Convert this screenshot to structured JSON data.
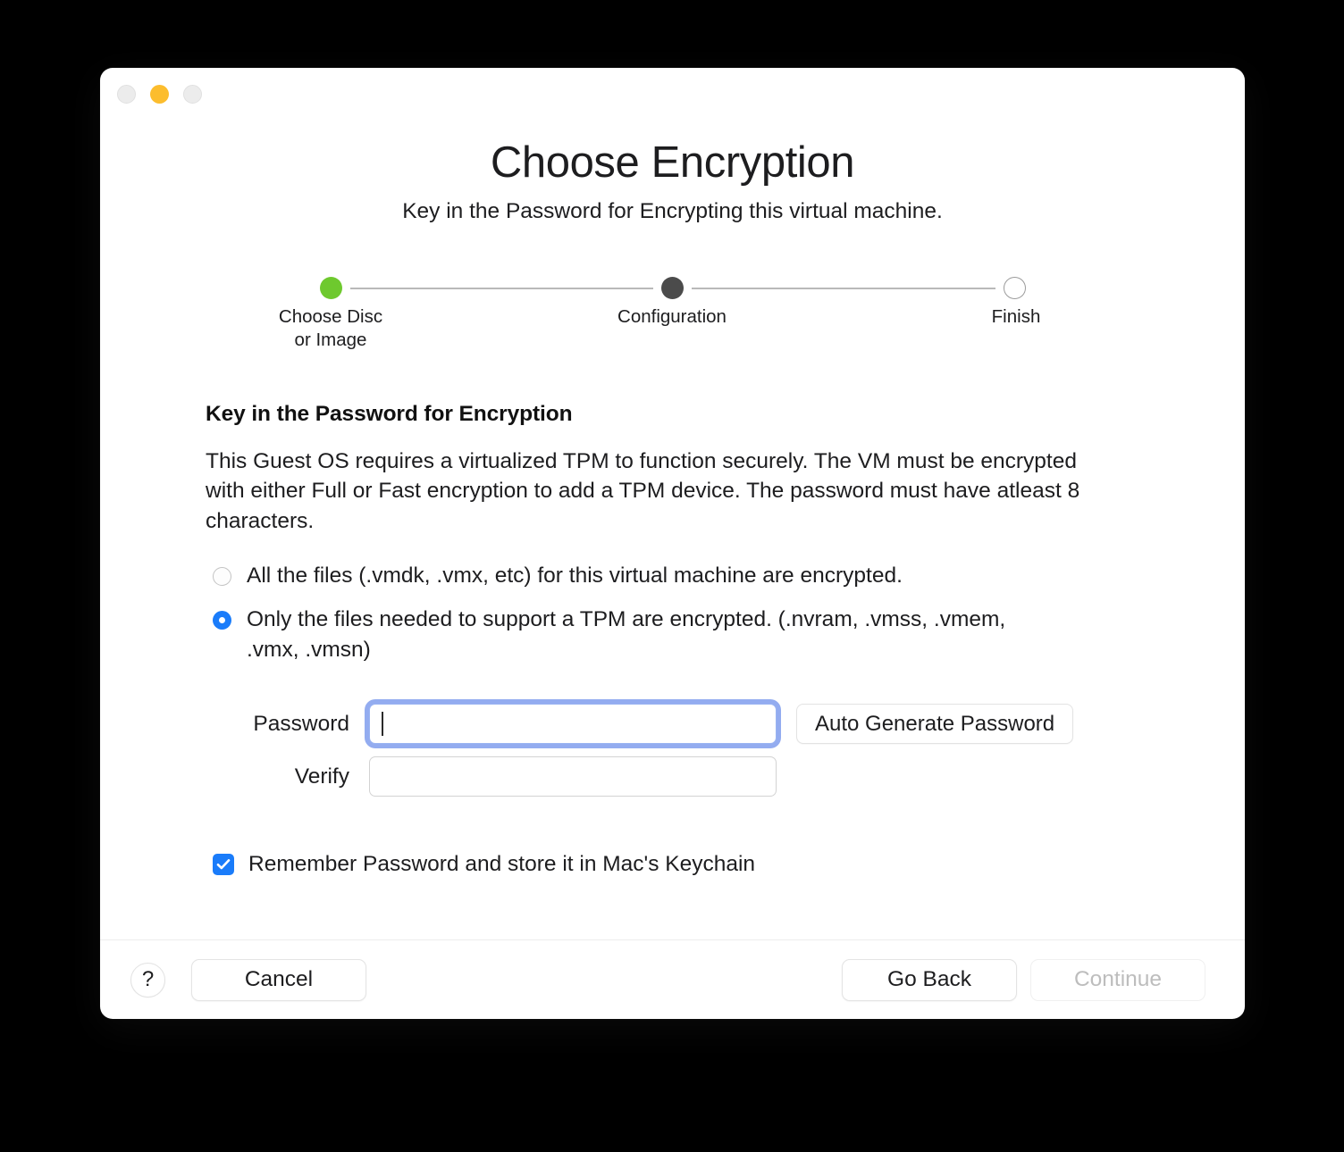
{
  "window": {
    "traffic_lights": [
      {
        "name": "close",
        "color": "#ececec"
      },
      {
        "name": "minimize",
        "color": "#fcbd2e"
      },
      {
        "name": "zoom",
        "color": "#ececec"
      }
    ]
  },
  "header": {
    "title": "Choose Encryption",
    "subtitle": "Key in the Password for Encrypting this virtual machine."
  },
  "stepper": {
    "steps": [
      {
        "label": "Choose Disc\nor Image",
        "state": "done",
        "color": "#6ec92e"
      },
      {
        "label": "Configuration",
        "state": "current",
        "color": "#4b4b4b"
      },
      {
        "label": "Finish",
        "state": "todo",
        "color": "#ffffff"
      }
    ]
  },
  "main": {
    "section_heading": "Key in the Password for Encryption",
    "section_description": "This Guest OS requires a virtualized TPM to function securely. The VM must be encrypted with either Full or Fast encryption to add a TPM device. The password must have atleast 8 characters.",
    "radios": [
      {
        "label": "All the files (.vmdk, .vmx, etc) for this virtual machine are encrypted.",
        "selected": false
      },
      {
        "label": "Only the files needed to support a TPM are encrypted. (.nvram, .vmss, .vmem, .vmx, .vmsn)",
        "selected": true
      }
    ],
    "fields": {
      "password_label": "Password",
      "password_value": "",
      "password_placeholder": "",
      "verify_label": "Verify",
      "verify_value": "",
      "verify_placeholder": "",
      "auto_generate_label": "Auto Generate Password"
    },
    "checkbox": {
      "label": "Remember Password and store it in Mac's Keychain",
      "checked": true
    }
  },
  "footer": {
    "help_label": "?",
    "cancel_label": "Cancel",
    "go_back_label": "Go Back",
    "continue_label": "Continue",
    "continue_disabled": true
  },
  "colors": {
    "accent_blue": "#1a7cfa",
    "focus_ring": "#93acf0",
    "step_done_green": "#6ec92e",
    "step_current_gray": "#4b4b4b",
    "disabled_text": "#bdbdbd"
  }
}
